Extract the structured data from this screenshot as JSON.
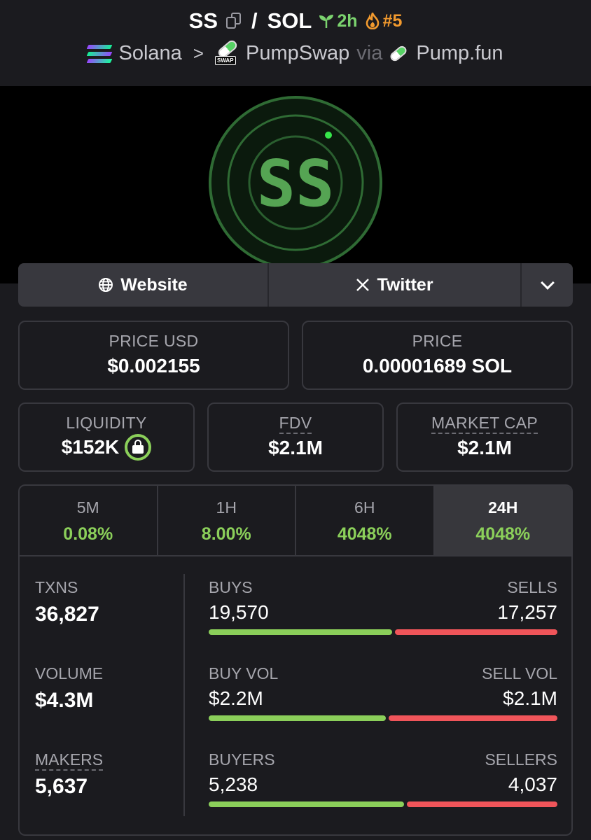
{
  "header": {
    "symbol": "SS",
    "quote": "SOL",
    "separator": "/",
    "age": "2h",
    "rank": "#5",
    "chain": "Solana",
    "dex": "PumpSwap",
    "via": "via",
    "launchpad": "Pump.fun",
    "swap_tag": "SWAP"
  },
  "banner": {
    "logo_text": "SS"
  },
  "social": {
    "website": "Website",
    "twitter": "Twitter"
  },
  "prices": {
    "price_usd_label": "PRICE USD",
    "price_usd": "$0.002155",
    "price_label": "PRICE",
    "price_sol": "0.00001689 SOL"
  },
  "metrics": {
    "liquidity_label": "LIQUIDITY",
    "liquidity": "$152K",
    "fdv_label": "FDV",
    "fdv": "$2.1M",
    "mcap_label": "MARKET CAP",
    "mcap": "$2.1M"
  },
  "tabs": [
    {
      "label": "5M",
      "change": "0.08%"
    },
    {
      "label": "1H",
      "change": "8.00%"
    },
    {
      "label": "6H",
      "change": "4048%"
    },
    {
      "label": "24H",
      "change": "4048%"
    }
  ],
  "stats": {
    "txns_label": "TXNS",
    "txns": "36,827",
    "volume_label": "VOLUME",
    "volume": "$4.3M",
    "makers_label": "MAKERS",
    "makers": "5,637"
  },
  "split": {
    "buys_label": "BUYS",
    "buys": "19,570",
    "sells_label": "SELLS",
    "sells": "17,257",
    "buys_ratio": 0.531,
    "buyvol_label": "BUY VOL",
    "buyvol": "$2.2M",
    "sellvol_label": "SELL VOL",
    "sellvol": "$2.1M",
    "buyvol_ratio": 0.512,
    "buyers_label": "BUYERS",
    "buyers": "5,238",
    "sellers_label": "SELLERS",
    "sellers": "4,037",
    "buyers_ratio": 0.565
  },
  "colors": {
    "positive": "#8bcf5a",
    "negative": "#f0555a",
    "accent_orange": "#f29a2e"
  },
  "icons": [
    "copy-icon",
    "sprout-icon",
    "flame-icon",
    "solana-icon",
    "pumpswap-icon",
    "pumpfun-icon",
    "globe-icon",
    "x-icon",
    "chevron-down-icon",
    "lock-icon"
  ]
}
